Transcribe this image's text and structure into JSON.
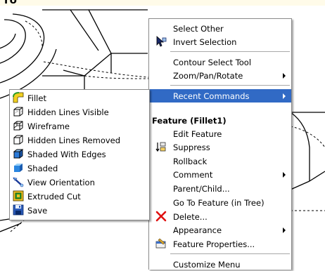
{
  "context_menu": {
    "items": [
      {
        "label": "Select Other"
      },
      {
        "label": "Invert Selection",
        "icon": "invert-selection-icon"
      },
      {
        "label": "Contour Select Tool"
      },
      {
        "label": "Zoom/Pan/Rotate",
        "has_submenu": true
      },
      {
        "label": "Recent Commands",
        "has_submenu": true,
        "highlighted": true
      },
      {
        "label": "Feature (Fillet1)",
        "header": true
      },
      {
        "label": "Edit Feature"
      },
      {
        "label": "Suppress",
        "icon": "suppress-icon"
      },
      {
        "label": "Rollback"
      },
      {
        "label": "Comment",
        "has_submenu": true
      },
      {
        "label": "Parent/Child..."
      },
      {
        "label": "Go To Feature (in Tree)"
      },
      {
        "label": "Delete...",
        "icon": "delete-icon"
      },
      {
        "label": "Appearance",
        "has_submenu": true
      },
      {
        "label": "Feature Properties...",
        "icon": "feature-properties-icon"
      },
      {
        "label": "Customize Menu"
      }
    ]
  },
  "recent_commands_submenu": {
    "items": [
      {
        "label": "Fillet",
        "icon": "fillet-icon"
      },
      {
        "label": "Hidden Lines Visible",
        "icon": "hidden-lines-visible-icon"
      },
      {
        "label": "Wireframe",
        "icon": "wireframe-icon"
      },
      {
        "label": "Hidden Lines Removed",
        "icon": "hidden-lines-removed-icon"
      },
      {
        "label": "Shaded With Edges",
        "icon": "shaded-with-edges-icon"
      },
      {
        "label": "Shaded",
        "icon": "shaded-icon"
      },
      {
        "label": "View Orientation",
        "icon": "view-orientation-icon"
      },
      {
        "label": "Extruded Cut",
        "icon": "extruded-cut-icon"
      },
      {
        "label": "Save",
        "icon": "save-icon"
      }
    ]
  },
  "colors": {
    "highlight": "#316ac5",
    "delete_red": "#e01010"
  }
}
